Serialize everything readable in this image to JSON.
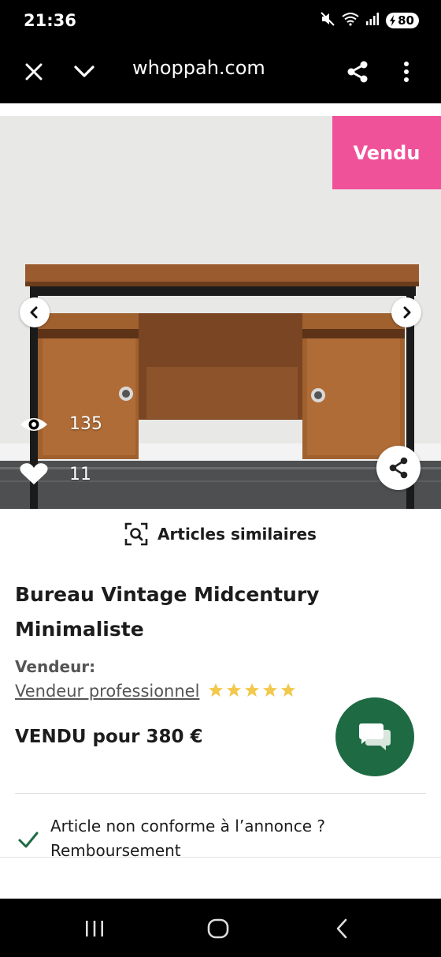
{
  "status_bar": {
    "time": "21:36",
    "battery": "80",
    "icons": [
      "mute-icon",
      "wifi-icon",
      "signal-icon",
      "battery-icon"
    ]
  },
  "browser": {
    "url": "whoppah.com",
    "icons": [
      "close-icon",
      "chevron-down-icon",
      "share-icon",
      "more-vertical-icon"
    ]
  },
  "product_image": {
    "sold_badge": "Vendu",
    "views": "135",
    "likes": "11",
    "badge_color": "#f0529a"
  },
  "similar_articles": {
    "label": "Articles similaires"
  },
  "product": {
    "title": "Bureau Vintage Midcentury Minimaliste",
    "seller_label": "Vendeur:",
    "seller_name": "Vendeur professionnel",
    "rating": 5,
    "price": "VENDU pour 380 €"
  },
  "guarantee": {
    "line1": "Article non conforme à l’annonce ?",
    "line2": "Remboursement"
  },
  "colors": {
    "chat_button": "#1e6b43",
    "star": "#f2c94c",
    "check": "#1e6b43"
  }
}
